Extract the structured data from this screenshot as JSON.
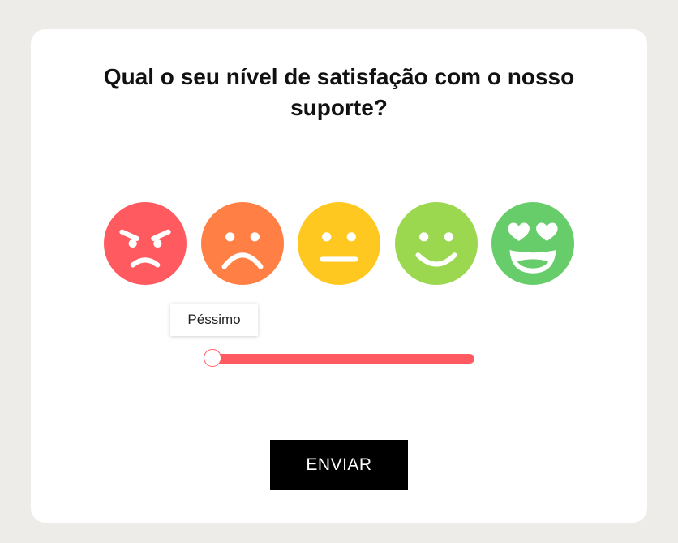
{
  "question": {
    "line1": "Qual o seu nível de satisfação com o nosso",
    "line2": "suporte?"
  },
  "ratings": [
    {
      "icon": "angry-face-icon",
      "color": "#ff5a60"
    },
    {
      "icon": "sad-face-icon",
      "color": "#ff7f45"
    },
    {
      "icon": "neutral-face-icon",
      "color": "#ffc820"
    },
    {
      "icon": "smiling-face-icon",
      "color": "#9bd84f"
    },
    {
      "icon": "heart-eyes-face-icon",
      "color": "#67cc6a"
    }
  ],
  "slider": {
    "value": 1,
    "min": 1,
    "max": 5,
    "tooltip": "Péssimo",
    "color": "#ff5a60"
  },
  "submit_label": "ENVIAR"
}
